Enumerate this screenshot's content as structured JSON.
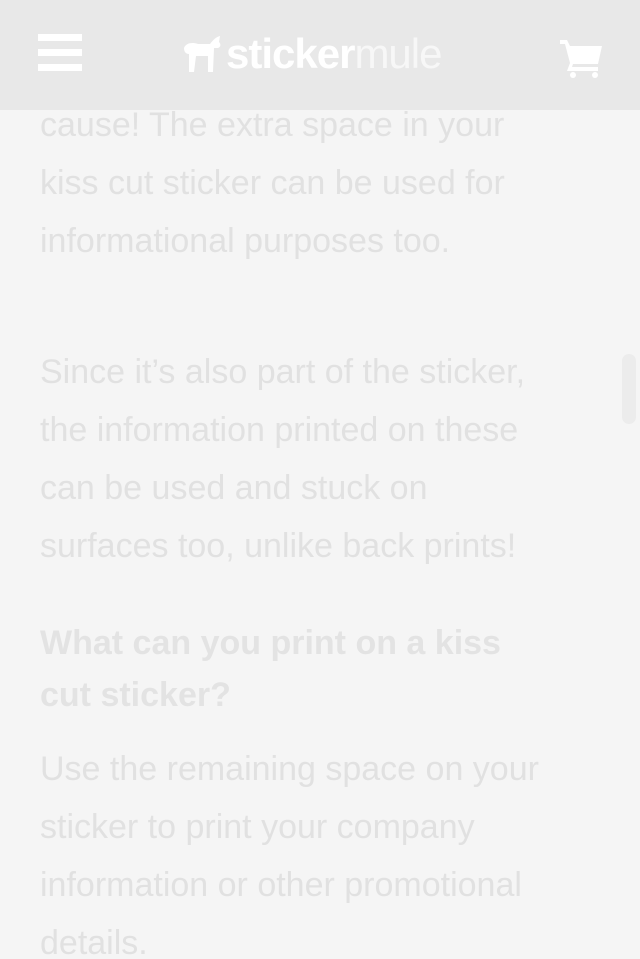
{
  "header": {
    "logo_word_1": "sticker",
    "logo_word_2": "mule",
    "menu_icon": "hamburger-menu-icon",
    "logo_icon": "mule-logo-icon",
    "cart_icon": "shopping-cart-icon"
  },
  "article": {
    "paragraph_1_lines": [
      "cause! The extra space in your",
      "kiss cut sticker can be used for",
      "informational purposes too."
    ],
    "paragraph_2_lines": [
      "Since it’s also part of the sticker,",
      "the information printed on these",
      "can be used and stuck on",
      "surfaces too, unlike back prints!"
    ],
    "heading_lines": [
      "What can you print on a kiss",
      "cut sticker?"
    ],
    "paragraph_3_lines": [
      "Use the remaining space on your",
      "sticker to print your company",
      "information or other promotional",
      "details."
    ]
  },
  "colors": {
    "header_bg": "#e8e8e8",
    "page_bg": "#f5f5f5",
    "text": "#e1e1e1"
  }
}
